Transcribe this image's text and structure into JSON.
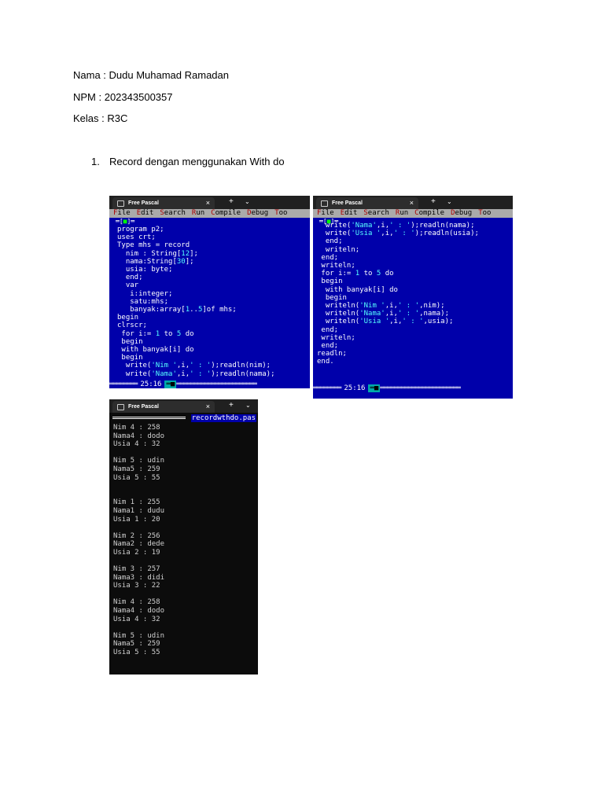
{
  "header": {
    "nama": "Nama : Dudu Muhamad Ramadan",
    "npm": "NPM : 202343500357",
    "kelas": "Kelas : R3C"
  },
  "section": {
    "number": "1.",
    "title": "Record dengan menggunakan With do"
  },
  "screenshot1": {
    "tab_title": "Free Pascal",
    "menu": [
      "File",
      "Edit",
      "Search",
      "Run",
      "Compile",
      "Debug",
      "Too"
    ],
    "code": [
      "program p2;",
      "uses crt;",
      "Type mhs = record",
      "  nim : String[12];",
      "  nama:String[30];",
      "  usia: byte;",
      "  end;",
      "  var",
      "   i:integer;",
      "   satu:mhs;",
      "   banyak:array[1..5]of mhs;",
      "begin",
      "clrscr;",
      " for i:= 1 to 5 do",
      " begin",
      " with banyak[i] do",
      " begin",
      "  write('Nim ',i,' : ');readln(nim);",
      "  write('Nama',i,' : ');readln(nama);"
    ],
    "cursor": "25:16"
  },
  "screenshot2": {
    "tab_title": "Free Pascal",
    "menu": [
      "File",
      "Edit",
      "Search",
      "Run",
      "Compile",
      "Debug",
      "Too"
    ],
    "code": [
      "  write('Nama',i,' : ');readln(nama);",
      "  write('Usia ',i,' : ');readln(usia);",
      "  end;",
      "  writeln;",
      " end;",
      " writeln;",
      " for i:= 1 to 5 do",
      " begin",
      "  with banyak[i] do",
      "  begin",
      "  writeln('Nim ',i,' : ',nim);",
      "  writeln('Nama',i,' : ',nama);",
      "  writeln('Usia ',i,' : ',usia);",
      " end;",
      " writeln;",
      " end;",
      "readln;",
      "end."
    ],
    "cursor": "25:16"
  },
  "screenshot3": {
    "tab_title": "Free Pascal",
    "filename": "recordwthdo.pas",
    "output": [
      "Nim 4 : 258",
      "Nama4 : dodo",
      "Usia 4 : 32",
      "",
      "Nim 5 : udin",
      "Nama5 : 259",
      "Usia 5 : 55",
      "",
      "",
      "Nim 1 : 255",
      "Nama1 : dudu",
      "Usia 1 : 20",
      "",
      "Nim 2 : 256",
      "Nama2 : dede",
      "Usia 2 : 19",
      "",
      "Nim 3 : 257",
      "Nama3 : didi",
      "Usia 3 : 22",
      "",
      "Nim 4 : 258",
      "Nama4 : dodo",
      "Usia 4 : 32",
      "",
      "Nim 5 : udin",
      "Nama5 : 259",
      "Usia 5 : 55"
    ]
  }
}
